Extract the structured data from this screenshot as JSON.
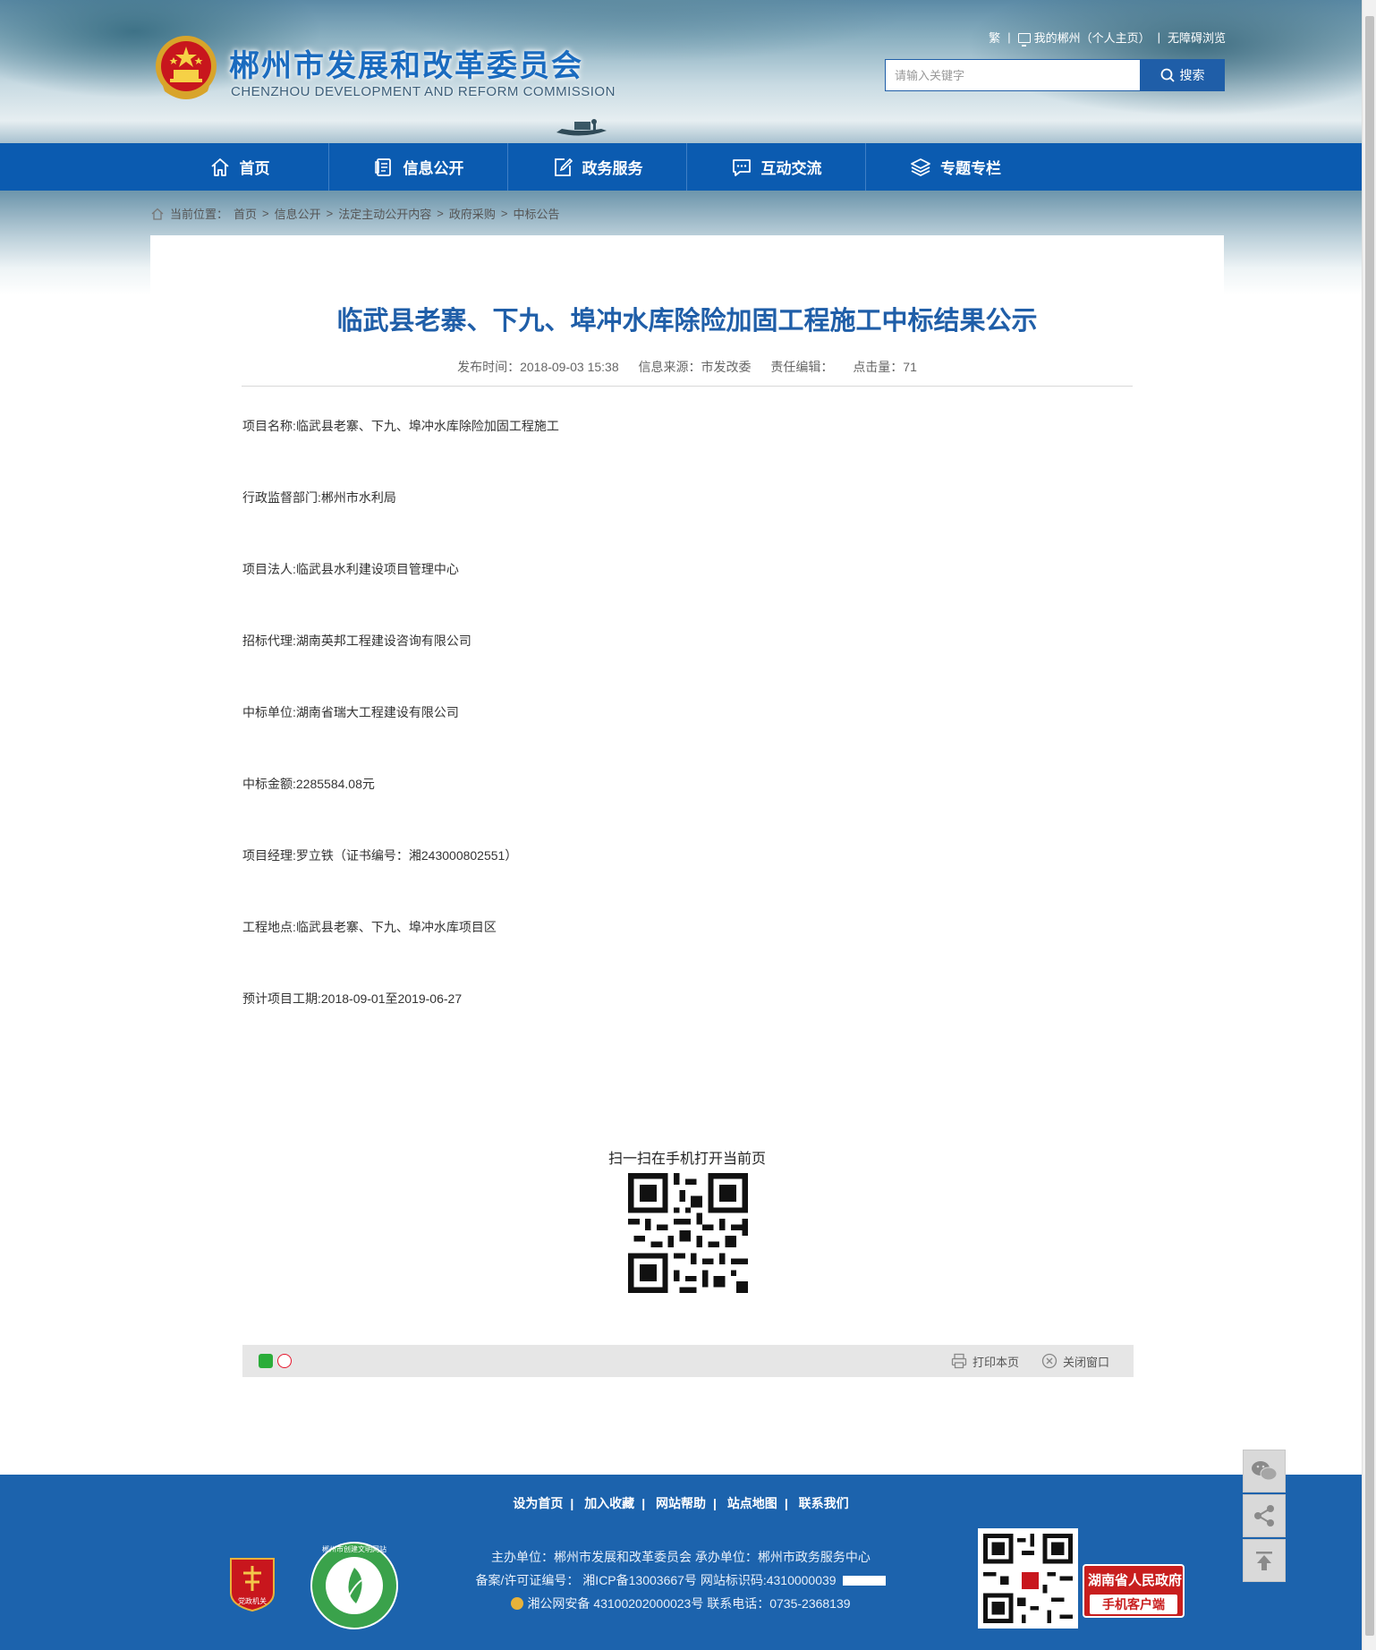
{
  "header": {
    "title": "郴州市发展和改革委员会",
    "subtitle": "CHENZHOU DEVELOPMENT AND REFORM COMMISSION",
    "links": {
      "traditional": "繁",
      "my_chenzhou": "我的郴州（个人主页）",
      "accessible": "无障碍浏览"
    },
    "search": {
      "placeholder": "请输入关键字",
      "button": "搜索"
    }
  },
  "nav": {
    "items": [
      {
        "label": "首页",
        "icon": "home-icon"
      },
      {
        "label": "信息公开",
        "icon": "document-icon"
      },
      {
        "label": "政务服务",
        "icon": "edit-icon"
      },
      {
        "label": "互动交流",
        "icon": "chat-icon"
      },
      {
        "label": "专题专栏",
        "icon": "layers-icon"
      }
    ]
  },
  "breadcrumb": {
    "prefix": "当前位置：",
    "items": [
      "首页",
      "信息公开",
      "法定主动公开内容",
      "政府采购",
      "中标公告"
    ],
    "separator": ">"
  },
  "article": {
    "title": "临武县老寨、下九、埠冲水库除险加固工程施工中标结果公示",
    "meta": {
      "published": "发布时间：2018-09-03 15:38",
      "source": "信息来源：市发改委",
      "editor": "责任编辑：",
      "hits": "点击量：71"
    },
    "lines": [
      "项目名称:临武县老寨、下九、埠冲水库除险加固工程施工",
      "行政监督部门:郴州市水利局",
      "项目法人:临武县水利建设项目管理中心",
      "招标代理:湖南英邦工程建设咨询有限公司",
      "中标单位:湖南省瑞大工程建设有限公司",
      "中标金额:2285584.08元",
      "项目经理:罗立铁（证书编号：湘243000802551）",
      "工程地点:临武县老寨、下九、埠冲水库项目区",
      "预计项目工期:2018-09-01至2019-06-27"
    ],
    "qr_caption": "扫一扫在手机打开当前页",
    "share_actions": {
      "print": "打印本页",
      "close": "关闭窗口"
    }
  },
  "footer": {
    "links": [
      "设为首页",
      "加入收藏",
      "网站帮助",
      "站点地图",
      "联系我们"
    ],
    "sponsor": "主办单位：郴州市发展和改革委员会   承办单位：郴州市政务服务中心",
    "icp": "备案/许可证编号： 湘ICP备13003667号   网站标识码:4310000039",
    "police": "湘公网安备 43100202000023号   联系电话：0735-2368139",
    "badge1_text": "党政机关",
    "badge2_text": "郴州市创建文明网站",
    "hunan_gov": {
      "line1": "湖南省人民政府",
      "line2": "手机客户端"
    }
  },
  "colors": {
    "primary": "#0b5bb0",
    "title_blue": "#1f5ea8",
    "footer": "#1c63ad",
    "hunan_red": "#c81e1e"
  }
}
